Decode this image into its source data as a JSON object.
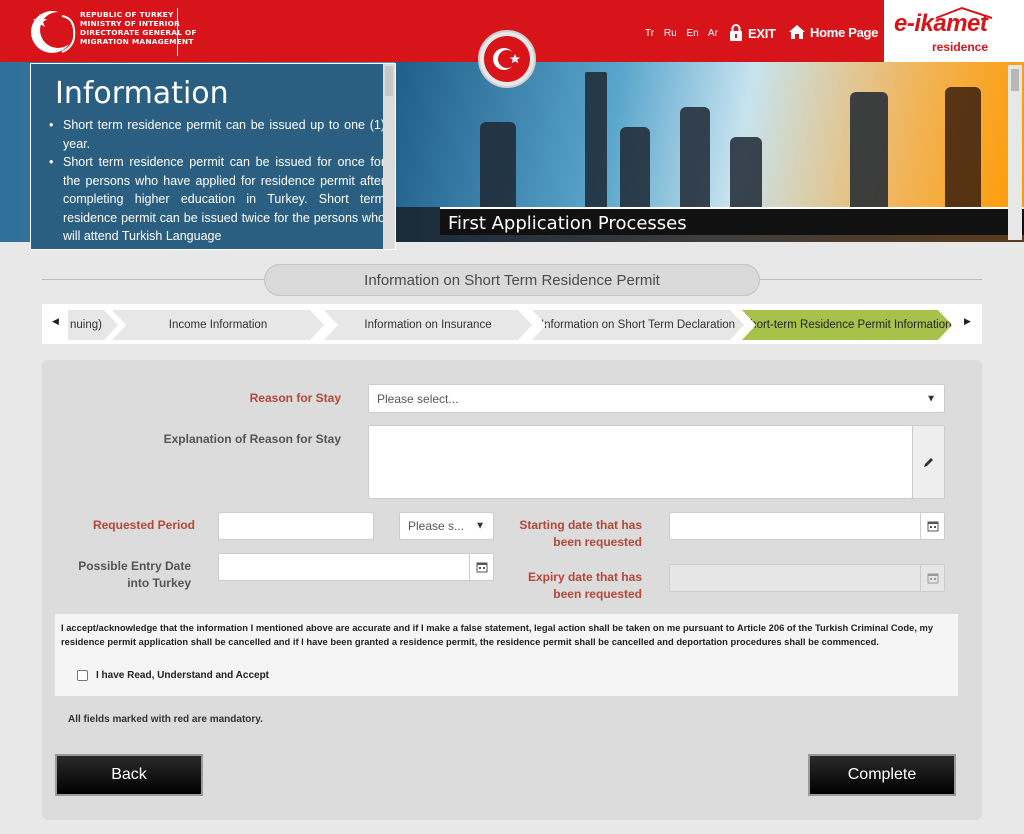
{
  "header": {
    "ministry_lines": [
      "REPUBLIC OF TURKEY",
      "MINISTRY OF INTERIOR",
      "DIRECTORATE GENERAL OF",
      "MIGRATION MANAGEMENT"
    ],
    "languages": [
      "Tr",
      "Ru",
      "En",
      "Ar"
    ],
    "exit_label": "EXIT",
    "home_label": "Home Page",
    "brand_main": "e-ikamet",
    "brand_sub": "residence",
    "brand_color": "#d8141b"
  },
  "info_panel": {
    "title": "Information",
    "items": [
      "Short term residence permit can be issued up to one (1) year.",
      "Short term residence permit can be issued for once for the persons who have applied for residence permit after completing higher education in Turkey. Short term residence permit can be issued twice for the persons who will attend Turkish Language"
    ]
  },
  "banner": {
    "process_title": "First Application Processes"
  },
  "section": {
    "title": "Information on Short Term Residence Permit"
  },
  "steps": {
    "items": [
      {
        "label": "nuing)",
        "active": false
      },
      {
        "label": "Income Information",
        "active": false
      },
      {
        "label": "Information on Insurance",
        "active": false
      },
      {
        "label": "Information on Short Term Declaration",
        "active": false
      },
      {
        "label": "Short-term Residence Permit Information",
        "active": true
      }
    ],
    "active_color": "#a6c24a"
  },
  "form": {
    "reason_label": "Reason for Stay",
    "reason_value": "Please select...",
    "explanation_label": "Explanation of Reason for Stay",
    "explanation_value": "",
    "requested_period_label": "Requested Period",
    "requested_period_value": "",
    "period_unit_value": "Please s...",
    "start_date_label_1": "Starting date that has",
    "start_date_label_2": "been requested",
    "start_date_value": "",
    "entry_date_label_1": "Possible Entry Date",
    "entry_date_label_2": "into Turkey",
    "entry_date_value": "",
    "expiry_date_label_1": "Expiry date that has",
    "expiry_date_label_2": "been requested",
    "expiry_date_value": ""
  },
  "consent": {
    "text": "I accept/acknowledge that the information I mentioned above are accurate and if I make a false statement, legal action shall be taken on me pursuant to Article 206 of the Turkish Criminal Code, my residence permit application shall be cancelled and if I have been granted a residence permit, the residence permit shall be cancelled and deportation procedures shall be commenced.",
    "checkbox_label": "I have Read, Understand and Accept",
    "checked": false
  },
  "mandatory_note": "All fields marked with red are mandatory.",
  "buttons": {
    "back": "Back",
    "complete": "Complete"
  }
}
